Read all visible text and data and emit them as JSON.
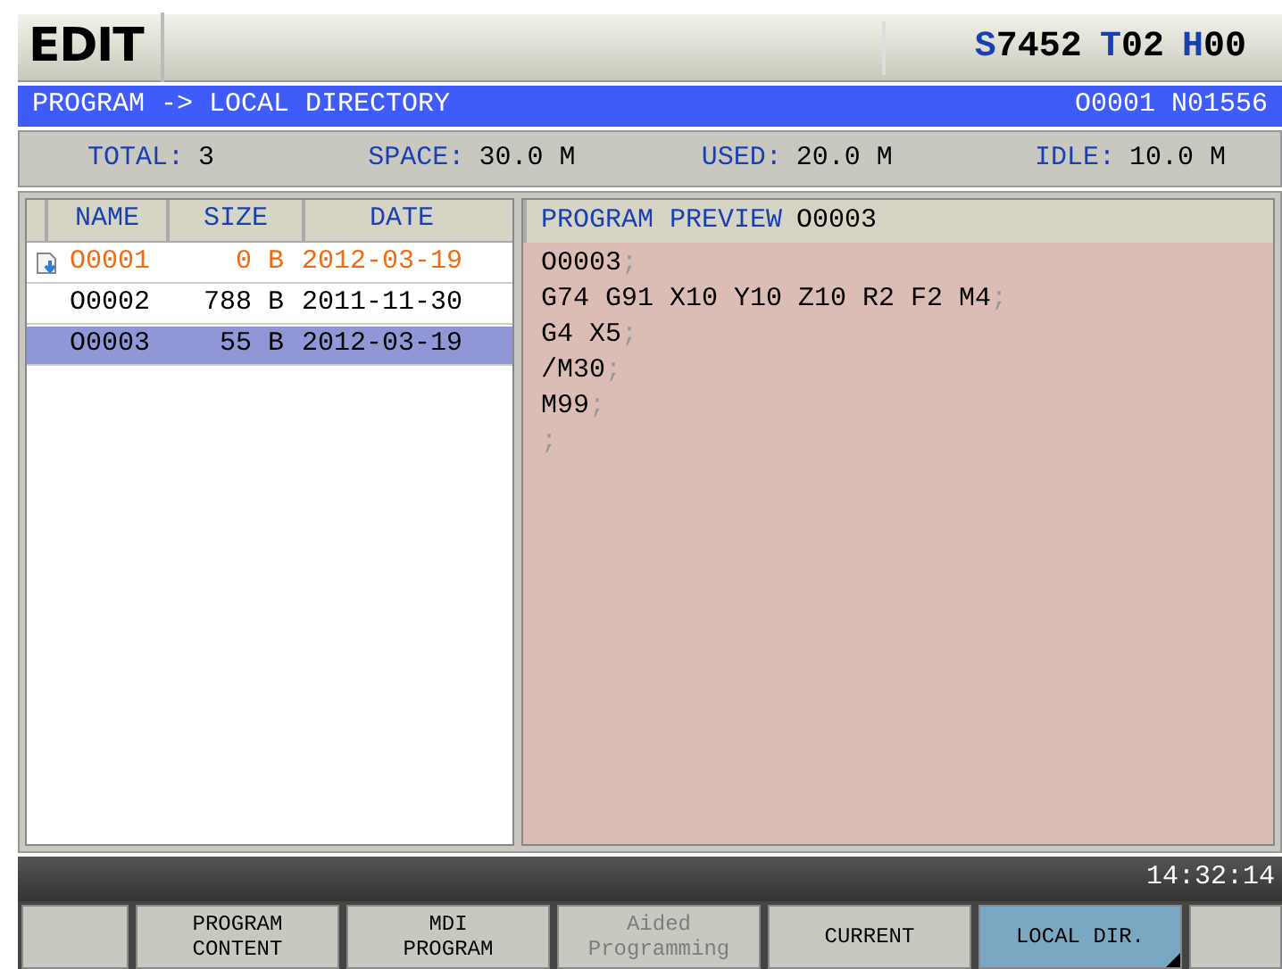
{
  "mode": "EDIT",
  "spindle": [
    {
      "letter": "S",
      "value": "7452"
    },
    {
      "letter": "T",
      "value": "02"
    },
    {
      "letter": "H",
      "value": "00"
    }
  ],
  "title_bar": {
    "path": "PROGRAM -> LOCAL DIRECTORY",
    "program": "O0001 N01556"
  },
  "info": [
    {
      "label": "TOTAL:",
      "value": "3"
    },
    {
      "label": "SPACE:",
      "value": "30.0 M"
    },
    {
      "label": "USED:",
      "value": "20.0 M"
    },
    {
      "label": "IDLE:",
      "value": "10.0 M"
    }
  ],
  "table": {
    "columns": [
      "NAME",
      "SIZE",
      "DATE"
    ],
    "rows": [
      {
        "name": "O0001",
        "size": "0 B",
        "date": "2012-03-19",
        "current": true,
        "selected": false
      },
      {
        "name": "O0002",
        "size": "788 B",
        "date": "2011-11-30",
        "current": false,
        "selected": false
      },
      {
        "name": "O0003",
        "size": "55 B",
        "date": "2012-03-19",
        "current": false,
        "selected": true
      }
    ]
  },
  "preview": {
    "label": "PROGRAM PREVIEW",
    "program": "O0003",
    "lines": [
      {
        "code": "O0003",
        "end": ";"
      },
      {
        "code": "G74 G91 X10 Y10 Z10 R2 F2 M4",
        "end": ";"
      },
      {
        "code": "G4 X5",
        "end": ";"
      },
      {
        "code": "/M30",
        "end": ";"
      },
      {
        "code": "M99",
        "end": ";"
      },
      {
        "end": ";"
      }
    ]
  },
  "clock": "14:32:14",
  "softkeys": [
    {
      "selected": false
    },
    {
      "lines": [
        "PROGRAM",
        "CONTENT"
      ],
      "disabled": false,
      "selected": false
    },
    {
      "lines": [
        "MDI",
        "PROGRAM"
      ],
      "disabled": false,
      "selected": false
    },
    {
      "lines": [
        "Aided",
        "Programming"
      ],
      "disabled": true,
      "selected": false
    },
    {
      "lines": [
        "CURRENT"
      ],
      "disabled": false,
      "selected": false
    },
    {
      "lines": [
        "LOCAL DIR."
      ],
      "disabled": false,
      "selected": true
    },
    {
      "selected": false
    }
  ]
}
